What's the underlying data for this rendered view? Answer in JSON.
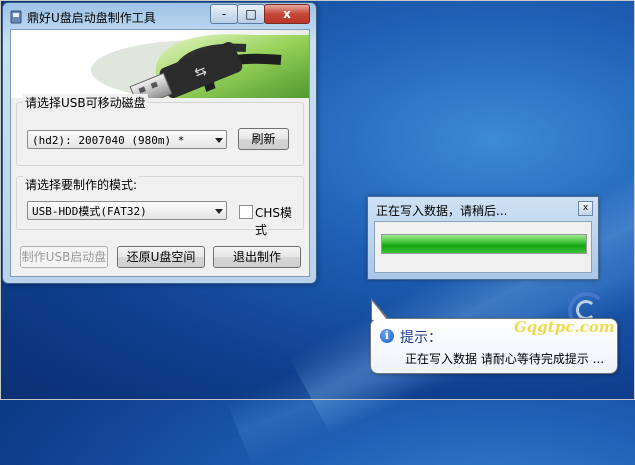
{
  "desktop": {
    "watermark": "Gqgtpc.com"
  },
  "window": {
    "title": "鼎好U盘启动盘制作工具",
    "controls": {
      "minimize": "-",
      "maximize": "□",
      "close": "x"
    },
    "disk_group": {
      "label": "请选择USB可移动磁盘",
      "selected_disk": "(hd2): 2007040 (980m) *",
      "refresh_button": "刷新"
    },
    "mode_group": {
      "label": "请选择要制作的模式:",
      "selected_mode": "USB-HDD模式(FAT32)",
      "chs_checkbox_label": "CHS模式",
      "chs_checked": false
    },
    "buttons": {
      "make_usb": "制作USB启动盘",
      "restore_space": "还原U盘空间",
      "exit": "退出制作"
    }
  },
  "progress_dialog": {
    "title": "正在写入数据，请稍后...",
    "close": "x",
    "progress": 1.0
  },
  "balloon_tip": {
    "title": "提示：",
    "message": "正在写入数据 请耐心等待完成提示 ..."
  },
  "colors": {
    "progress_green": "#13a313",
    "desktop_blue": "#1e5fb4",
    "watermark_yellow": "#e9cf1a"
  }
}
